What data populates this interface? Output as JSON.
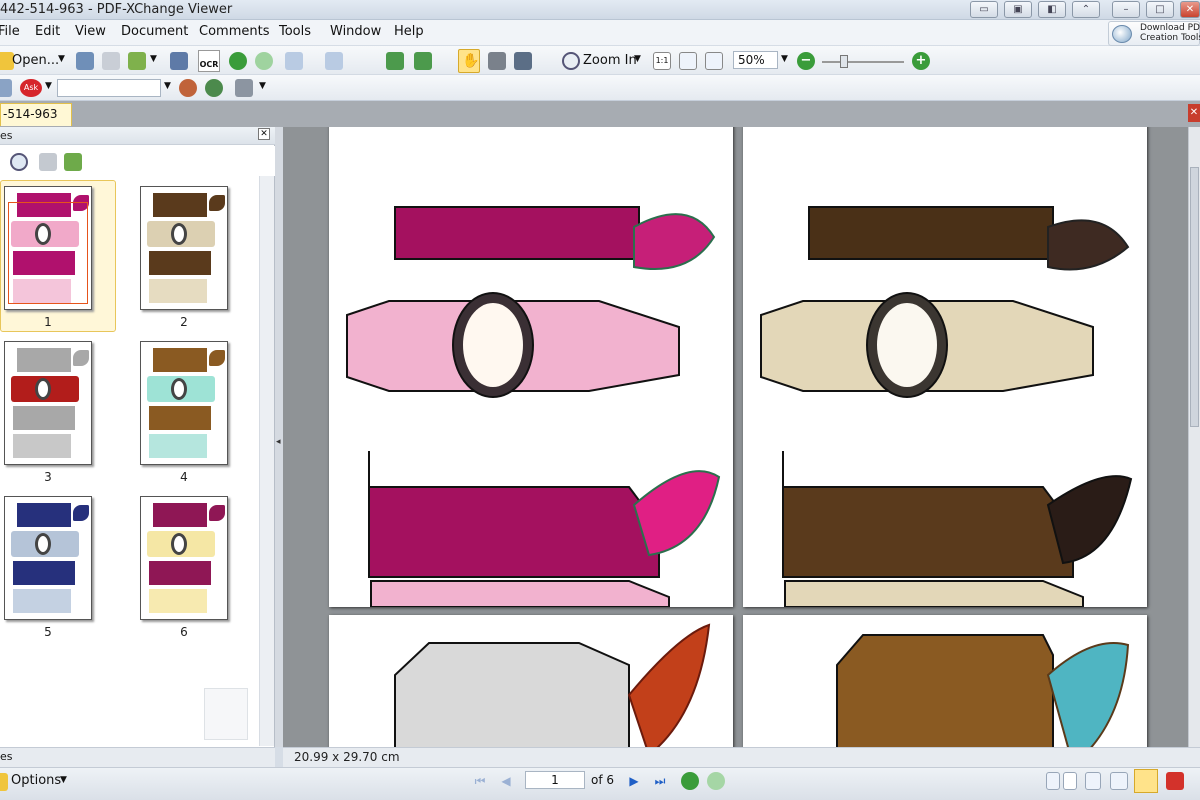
{
  "window": {
    "title": "442-514-963 - PDF-XChange Viewer",
    "download_line1": "Download PDF",
    "download_line2": "Creation Tools"
  },
  "menu": [
    "File",
    "Edit",
    "View",
    "Document",
    "Comments",
    "Tools",
    "Window",
    "Help"
  ],
  "toolbar": {
    "open_label": "Open...",
    "ocr_label": "OCR",
    "zoom_in_label": "Zoom In",
    "zoom_value": "50%",
    "fit_labels": [
      "1:1"
    ],
    "search_value": ""
  },
  "tab": {
    "label": "-514-963"
  },
  "panel": {
    "title": "es",
    "footer_label": "es",
    "options_label": "Options",
    "thumbnails": [
      {
        "number": "1",
        "color_top": "#b0116d",
        "color_mid": "#f1a9c9",
        "color_bottom": "#f4c5da"
      },
      {
        "number": "2",
        "color_top": "#5a3a1c",
        "color_mid": "#dcd0b2",
        "color_bottom": "#e6dcc1"
      },
      {
        "number": "3",
        "color_top": "#a8a8a8",
        "color_mid": "#b21d1b",
        "color_bottom": "#c8c8c8"
      },
      {
        "number": "4",
        "color_top": "#8a5a22",
        "color_mid": "#9ee3d6",
        "color_bottom": "#b5e6de"
      },
      {
        "number": "5",
        "color_top": "#26307c",
        "color_mid": "#b5c4d8",
        "color_bottom": "#c4d1e2"
      },
      {
        "number": "6",
        "color_top": "#8f1755",
        "color_mid": "#f5e7a5",
        "color_bottom": "#f7eab0"
      }
    ]
  },
  "document": {
    "page_size": "20.99 x 29.70 cm",
    "current_page": "1",
    "page_count_label": "of 6"
  },
  "colors": {
    "accent": "#e2c04a",
    "doc_bg": "#8f9396",
    "pink_dark": "#a4115f",
    "pink_light": "#f2b2cf",
    "brown_dark": "#4a3017",
    "cream": "#e3d7b8"
  }
}
